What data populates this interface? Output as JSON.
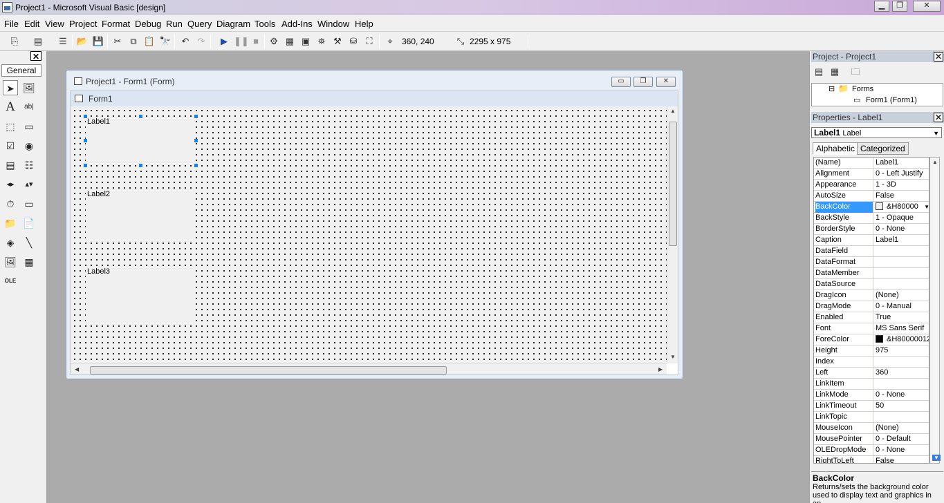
{
  "window": {
    "title": "Project1 - Microsoft Visual Basic [design]",
    "min": "▁",
    "max": "❐",
    "close": "✕"
  },
  "menu": [
    "File",
    "Edit",
    "View",
    "Project",
    "Format",
    "Debug",
    "Run",
    "Query",
    "Diagram",
    "Tools",
    "Add-Ins",
    "Window",
    "Help"
  ],
  "toolbar": {
    "position_readout": "360, 240",
    "size_readout": "2295 x 975"
  },
  "toolbox": {
    "tab": "General",
    "close": "✕"
  },
  "form_window": {
    "caption": "Project1 - Form1 (Form)",
    "min": "▭",
    "max": "❐",
    "close": "✕"
  },
  "form": {
    "caption": "Form1",
    "labels": [
      "Label1",
      "Label2",
      "Label3"
    ]
  },
  "project_explorer": {
    "title": "Project - Project1",
    "close": "✕",
    "folder": "Forms",
    "item": "Form1 (Form1)",
    "expander": "⊟"
  },
  "properties": {
    "title": "Properties - Label1",
    "close": "✕",
    "object_name": "Label1",
    "object_type": "Label",
    "tabs": [
      "Alphabetic",
      "Categorized"
    ],
    "rows": [
      {
        "name": "(Name)",
        "value": "Label1"
      },
      {
        "name": "Alignment",
        "value": "0 - Left Justify"
      },
      {
        "name": "Appearance",
        "value": "1 - 3D"
      },
      {
        "name": "AutoSize",
        "value": "False"
      },
      {
        "name": "BackColor",
        "value": "&H80000"
      },
      {
        "name": "BackStyle",
        "value": "1 - Opaque"
      },
      {
        "name": "BorderStyle",
        "value": "0 - None"
      },
      {
        "name": "Caption",
        "value": "Label1"
      },
      {
        "name": "DataField",
        "value": ""
      },
      {
        "name": "DataFormat",
        "value": ""
      },
      {
        "name": "DataMember",
        "value": ""
      },
      {
        "name": "DataSource",
        "value": ""
      },
      {
        "name": "DragIcon",
        "value": "(None)"
      },
      {
        "name": "DragMode",
        "value": "0 - Manual"
      },
      {
        "name": "Enabled",
        "value": "True"
      },
      {
        "name": "Font",
        "value": "MS Sans Serif"
      },
      {
        "name": "ForeColor",
        "value": "&H80000012"
      },
      {
        "name": "Height",
        "value": "975"
      },
      {
        "name": "Index",
        "value": ""
      },
      {
        "name": "Left",
        "value": "360"
      },
      {
        "name": "LinkItem",
        "value": ""
      },
      {
        "name": "LinkMode",
        "value": "0 - None"
      },
      {
        "name": "LinkTimeout",
        "value": "50"
      },
      {
        "name": "LinkTopic",
        "value": ""
      },
      {
        "name": "MouseIcon",
        "value": "(None)"
      },
      {
        "name": "MousePointer",
        "value": "0 - Default"
      },
      {
        "name": "OLEDropMode",
        "value": "0 - None"
      },
      {
        "name": "RightToLeft",
        "value": "False"
      }
    ],
    "selected_row": "BackColor",
    "description_title": "BackColor",
    "description_text": "Returns/sets the background color used to display text and graphics in an"
  }
}
